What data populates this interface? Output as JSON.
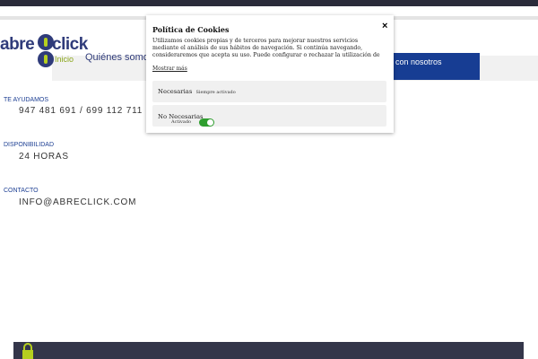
{
  "nav": {
    "inicio": "Inicio",
    "quienes": "Quiénes somos",
    "contact_cta": "con nosotros"
  },
  "logo": {
    "abre": "abre",
    "click": "click"
  },
  "info": {
    "help_label": "TE AYUDAMOS",
    "phones": "947 481 691 / 699 112 711",
    "availability_label": "DISPONIBILIDAD",
    "availability_value": "24 HORAS",
    "contact_label": "CONTACTO",
    "email": "INFO@ABRECLICK.COM"
  },
  "cookie_modal": {
    "title": "Política de Cookies",
    "body": "Utilizamos cookies propias y de terceros para mejorar nuestros servicios mediante el análisis de sus hábitos de navegación. Si continúa navegando, consideraremos que acepta su uso. Puede configurar o rechazar la utilización de cookies u obtener",
    "more_link": "Mostrar más",
    "close": "×",
    "categories": [
      {
        "label": "Necesarias",
        "status": "Siempre activado"
      },
      {
        "label": "No Necesarias",
        "status": "Activado",
        "enabled": true
      }
    ]
  },
  "colors": {
    "brand_blue": "#2f3b7a",
    "brand_green": "#b6cf1f",
    "cta_blue": "#173d93",
    "dark_bar": "#2a2b3a",
    "toggle_on": "#2f9e2f"
  }
}
